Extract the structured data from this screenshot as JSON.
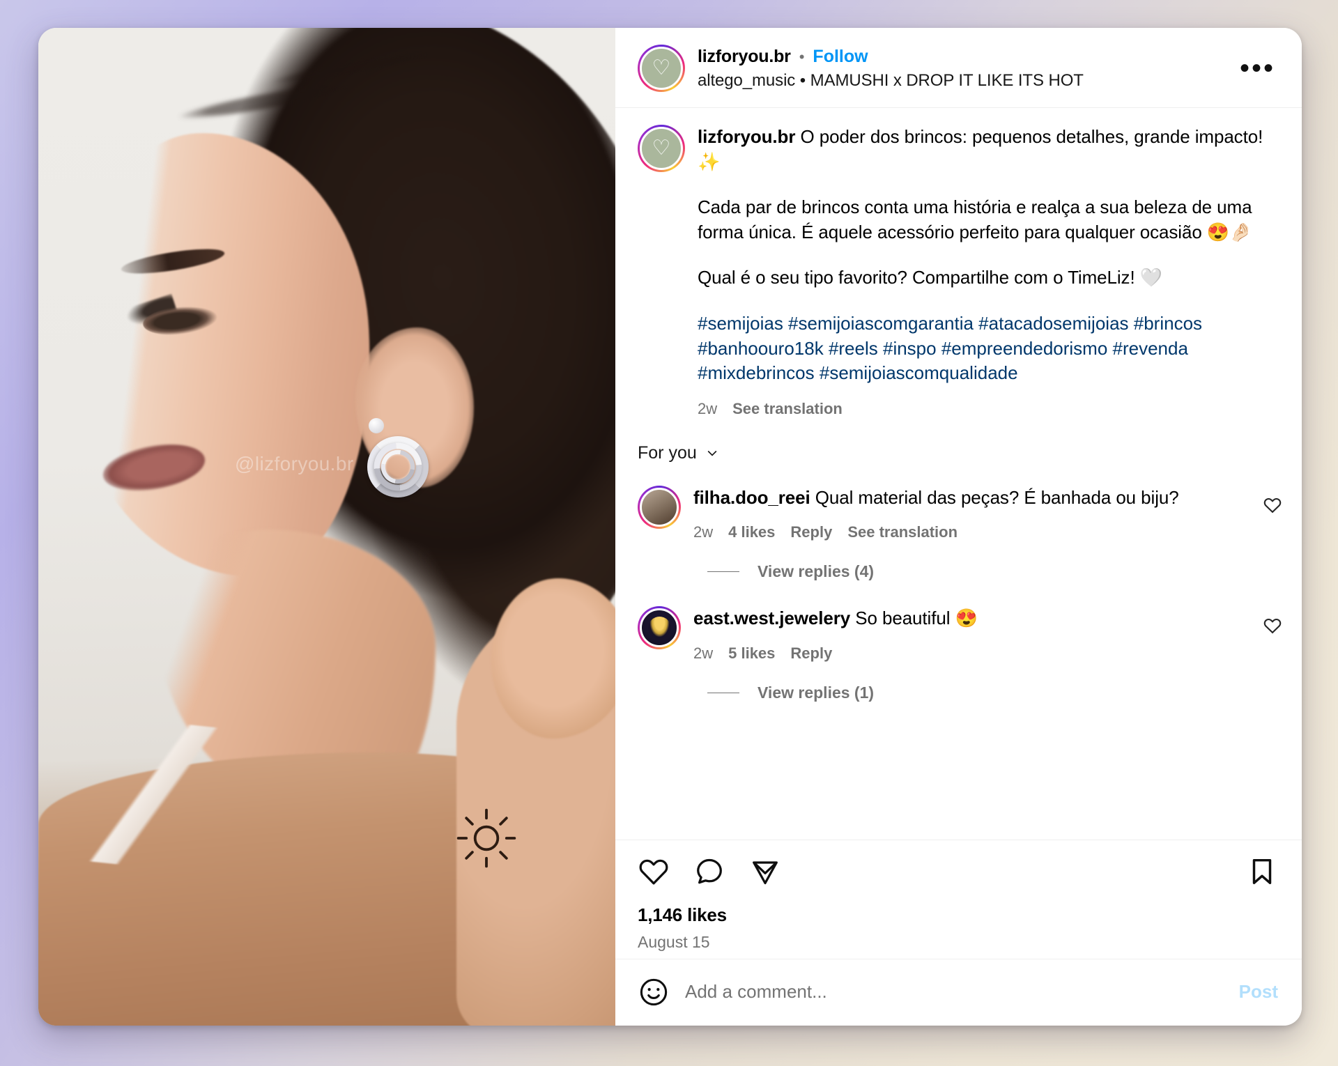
{
  "post": {
    "header": {
      "username": "lizforyou.br",
      "separator": "•",
      "follow_label": "Follow",
      "audio_attribution": "altego_music  •  MAMUSHI x DROP IT LIKE ITS HOT",
      "more_options": "•••"
    },
    "caption": {
      "username": "lizforyou.br",
      "line1": "O poder dos brincos: pequenos detalhes, grande impacto! ✨",
      "paragraph2": "Cada par de brincos conta uma história e realça a sua beleza de uma forma única. É aquele acessório perfeito para qualquer ocasião 😍🤌🏻",
      "paragraph3": "Qual é o seu tipo favorito? Compartilhe com o TimeLiz! 🤍",
      "hashtags": "#semijoias #semijoiascomgarantia #atacadosemijoias #brincos #banhoouro18k #reels #inspo #empreendedorismo #revenda #mixdebrincos #semijoiascomqualidade",
      "timestamp": "2w",
      "see_translation": "See translation"
    },
    "comments_filter": {
      "label": "For you",
      "chevron": "chevron-down-icon"
    },
    "comments": [
      {
        "username": "filha.doo_reei",
        "text": "Qual material das peças? É banhada ou biju?",
        "timestamp": "2w",
        "likes": "4 likes",
        "reply": "Reply",
        "see_translation": "See translation",
        "view_replies": "View replies (4)"
      },
      {
        "username": "east.west.jewelery",
        "text": "So beautiful 😍",
        "timestamp": "2w",
        "likes": "5 likes",
        "reply": "Reply",
        "see_translation": "",
        "view_replies": "View replies (1)"
      }
    ],
    "actions": {
      "like": "heart-icon",
      "comment": "comment-icon",
      "share": "share-icon",
      "save": "bookmark-icon",
      "likes_count": "1,146 likes",
      "date": "August 15"
    },
    "add_comment": {
      "emoji": "emoji-icon",
      "placeholder": "Add a comment...",
      "value": "",
      "post_label": "Post"
    },
    "media": {
      "watermark": "@lizforyou.br"
    }
  },
  "colors": {
    "accent_blue": "#0095f6",
    "link_blue": "#00376b",
    "muted_gray": "#737373",
    "post_disabled": "#b2dffc"
  }
}
